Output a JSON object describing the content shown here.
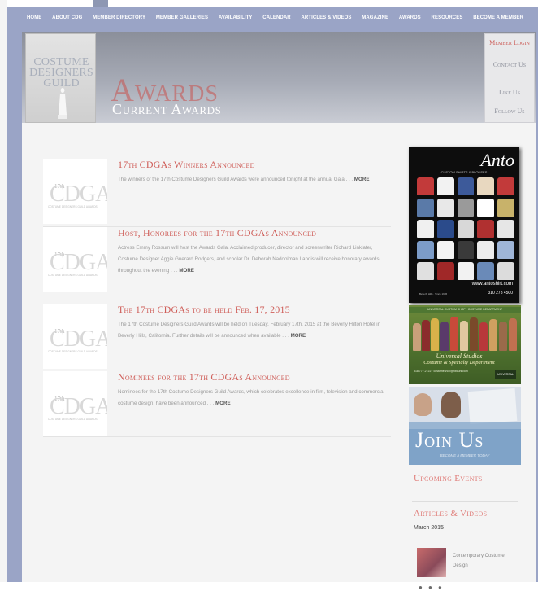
{
  "nav": {
    "items": [
      "HOME",
      "ABOUT CDG",
      "MEMBER DIRECTORY",
      "MEMBER GALLERIES",
      "AVAILABILITY",
      "CALENDAR",
      "ARTICLES & VIDEOS",
      "MAGAZINE",
      "AWARDS",
      "RESOURCES",
      "BECOME A MEMBER"
    ]
  },
  "header": {
    "logo_lines": [
      "COSTUME",
      "DESIGNERS",
      "GUILD"
    ],
    "title": "Awards",
    "subtitle": "Current Awards",
    "side_links": [
      "Member Login",
      "Contact Us",
      "Like Us",
      "Follow Us"
    ]
  },
  "news": [
    {
      "title": "17th CDGAs Winners Announced",
      "body": "The winners of the 17th Costume Designers Guild Awards were announced tonight at the annual Gala . . .",
      "more": "MORE"
    },
    {
      "title": "Host, Honorees for the 17th CDGAs Announced",
      "body": "Actress Emmy Rossum will host the Awards Gala. Acclaimed producer, director and screenwriter Richard Linklater, Costume Designer Aggie Guerard Rodgers, and scholar Dr. Deborah Nadoolman Landis will receive honorary awards throughout the evening . . .",
      "more": "MORE"
    },
    {
      "title": "The 17th CDGAs to be held Feb. 17, 2015",
      "body": "The 17th Costume Designers Guild Awards will be held on Tuesday, February 17th, 2015 at the Beverly Hilton Hotel in Beverly Hills, California. Further details will be announced when available . . .",
      "more": "MORE"
    },
    {
      "title": "Nominees for the 17th CDGAs Announced",
      "body": "Nominees for the 17th Costume Designers Guild Awards, which celebrates excellence in film, television and commercial costume design, have been announced . . .",
      "more": "MORE"
    }
  ],
  "cdga_logo": {
    "badge": "17th",
    "letters": "CDGA",
    "caption": "COSTUME DESIGNERS GUILD AWARDS"
  },
  "ads": {
    "anto": {
      "title": "Anto",
      "subtitle": "CUSTOM SHIRTS & BLOUSES",
      "url": "www.antoshirt.com",
      "phone": "310 278 4500",
      "footer": "Beverly Hills · Since 1955",
      "colors": [
        "#c23a3a",
        "#f2f2f2",
        "#3d5a9a",
        "#e8d8c0",
        "#c23a3a",
        "#5a7aa8",
        "#e8e8e8",
        "#9a9a9a",
        "#ffffff",
        "#c8b26a",
        "#f0f0f0",
        "#2b4b8b",
        "#d8d8d8",
        "#b03030",
        "#e6e6e6",
        "#7c9cc8",
        "#f4f4f4",
        "#3a3a3a",
        "#ececec",
        "#9fb6d8",
        "#e0e0e0",
        "#a02828",
        "#f2f2f2",
        "#6a8ab8",
        "#dcdcdc"
      ]
    },
    "universal": {
      "banner": "UNIVERSAL CUSTOM SHOP · COSTUME DEPARTMENT",
      "name": "Universal Studios",
      "spec": "Costume & Specialty Department",
      "contact": "818.777.2722 · costumeshop@nbcuni.com",
      "emblem": "UNIVERSAL"
    },
    "join": {
      "title": "Join Us",
      "subtitle": "BECOME A MEMBER TODAY"
    }
  },
  "sidebar": {
    "upcoming_events": "Upcoming Events",
    "articles_videos": "Articles & Videos",
    "month": "March 2015",
    "video_title": "Contemporary Costume Design",
    "social_icons": [
      "facebook-icon",
      "twitter-icon",
      "share-icon"
    ]
  }
}
